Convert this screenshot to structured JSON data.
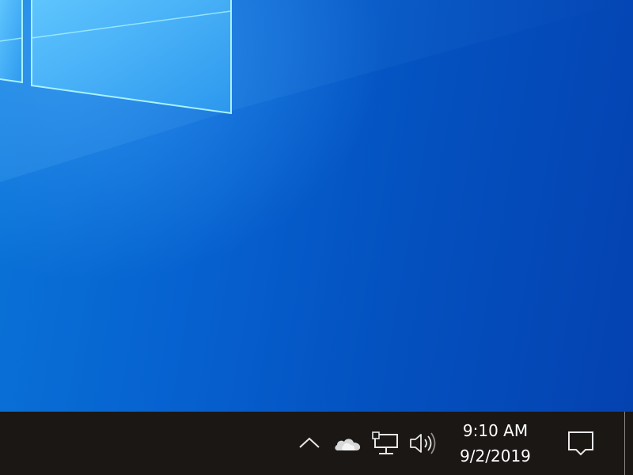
{
  "desktop": {
    "wallpaper": "windows-10-hero",
    "colors": {
      "background_light": "#0a74d8",
      "background_dark": "#0442b0",
      "window_pane": "#5fc6ff",
      "window_edge": "#a8f2ff"
    }
  },
  "taskbar": {
    "background_color": "#1b1714",
    "system_tray": {
      "icons": [
        {
          "name": "chevron-up-icon",
          "meaning": "show hidden icons"
        },
        {
          "name": "onedrive-icon",
          "meaning": "OneDrive"
        },
        {
          "name": "network-icon",
          "meaning": "Network"
        },
        {
          "name": "volume-icon",
          "meaning": "Volume"
        }
      ]
    },
    "clock": {
      "time": "9:10 AM",
      "date": "9/2/2019"
    },
    "action_center": {
      "icon": "notification-icon"
    }
  }
}
